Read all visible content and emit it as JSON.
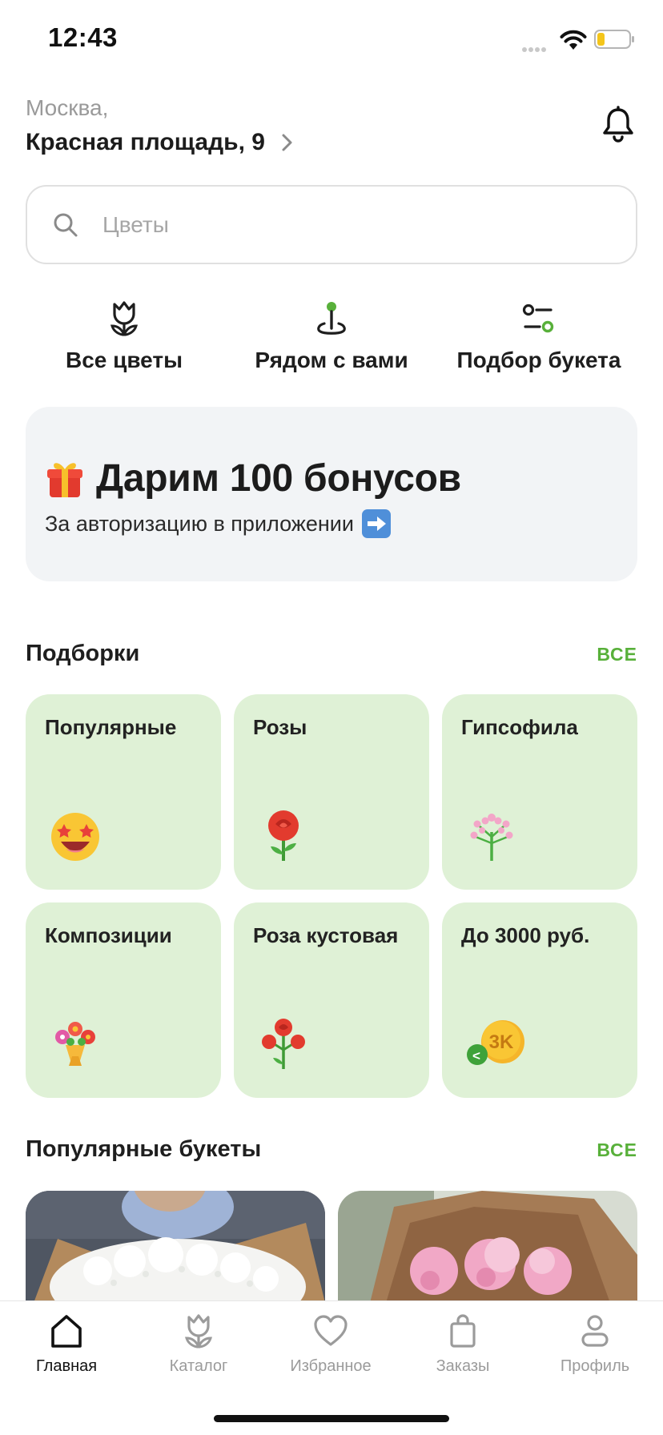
{
  "status_bar": {
    "time": "12:43"
  },
  "header": {
    "city": "Москва,",
    "address": "Красная площадь, 9"
  },
  "search": {
    "placeholder": "Цветы"
  },
  "quick_actions": [
    {
      "label": "Все цветы",
      "icon": "tulip-icon"
    },
    {
      "label": "Рядом с вами",
      "icon": "location-pin-icon"
    },
    {
      "label": "Подбор букета",
      "icon": "filter-icon"
    }
  ],
  "promo": {
    "icon": "gift-emoji",
    "title": "Дарим 100 бонусов",
    "subtitle": "За авторизацию в приложении",
    "arrow": "right-arrow-emoji"
  },
  "collections": {
    "title": "Подборки",
    "all_label": "ВСЕ",
    "items": [
      {
        "label": "Популярные",
        "emoji": "star-struck-emoji"
      },
      {
        "label": "Розы",
        "emoji": "rose-emoji"
      },
      {
        "label": "Гипсофила",
        "emoji": "gypsophila-emoji"
      },
      {
        "label": "Композиции",
        "emoji": "bouquet-emoji"
      },
      {
        "label": "Роза кустовая",
        "emoji": "spray-rose-emoji"
      },
      {
        "label": "До 3000 руб.",
        "emoji": "coin-3k-emoji",
        "coin_text": "3K",
        "badge_text": "<"
      }
    ]
  },
  "popular_bouquets": {
    "title": "Популярные букеты",
    "all_label": "ВСЕ"
  },
  "tab_bar": {
    "items": [
      {
        "label": "Главная",
        "icon": "home-icon",
        "active": true
      },
      {
        "label": "Каталог",
        "icon": "tulip-icon",
        "active": false
      },
      {
        "label": "Избранное",
        "icon": "heart-icon",
        "active": false
      },
      {
        "label": "Заказы",
        "icon": "shopping-bag-icon",
        "active": false
      },
      {
        "label": "Профиль",
        "icon": "profile-icon",
        "active": false
      }
    ]
  },
  "colors": {
    "accent_green": "#58b03a",
    "card_green": "#dff1d6",
    "promo_bg": "#f2f4f6"
  }
}
